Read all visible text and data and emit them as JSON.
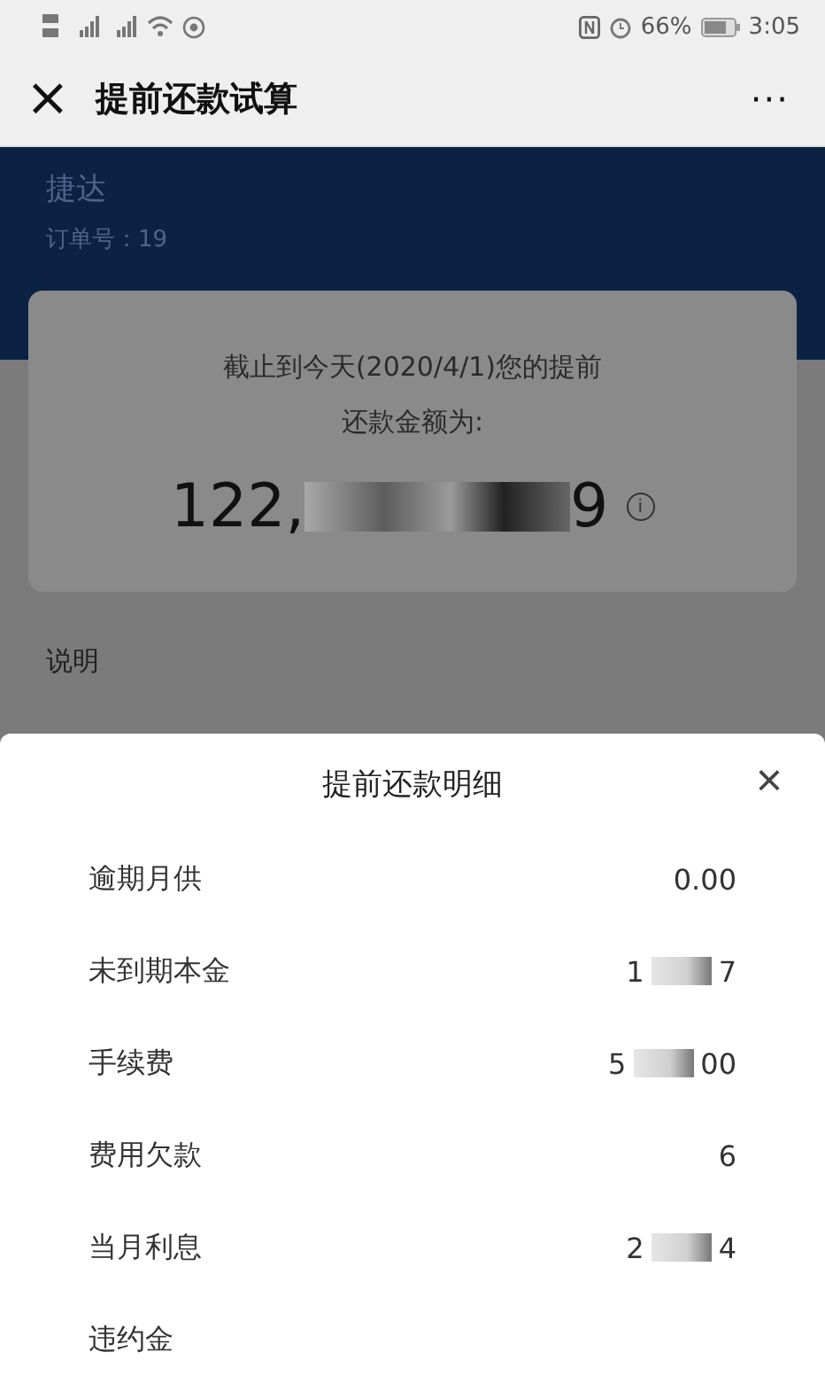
{
  "status_bar": {
    "battery": "66%",
    "time": "3:05"
  },
  "title_bar": {
    "close": "×",
    "title": "提前还款试算",
    "more": "···"
  },
  "header": {
    "car": "捷达",
    "order": "订单号：19"
  },
  "summary": {
    "text": "截止到今天(2020/4/1)您的提前还款金额为:",
    "amount_parts": [
      "122,",
      "9"
    ],
    "info": "i"
  },
  "notes": {
    "heading": "说明"
  },
  "sheet": {
    "title": "提前还款明细",
    "close": "×",
    "rows": [
      {
        "label": "逾期月供",
        "value_parts": [
          "0.00"
        ]
      },
      {
        "label": "未到期本金",
        "value_parts": [
          "1",
          "7"
        ]
      },
      {
        "label": "手续费",
        "value_parts": [
          "5",
          "00"
        ]
      },
      {
        "label": "费用欠款",
        "value_parts": [
          "6"
        ]
      },
      {
        "label": "当月利息",
        "value_parts": [
          "2",
          "4"
        ]
      },
      {
        "label": "违约金",
        "value_parts": []
      }
    ]
  }
}
